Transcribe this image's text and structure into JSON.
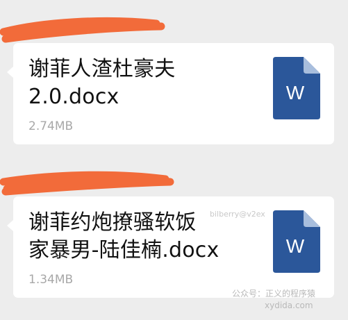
{
  "chat": {
    "messages": [
      {
        "type": "file",
        "file_name_line1": "谢菲人渣杜豪夫",
        "file_name_line2": "2.0.docx",
        "file_size": "2.74MB",
        "icon": "word-document-icon",
        "icon_letter": "W"
      },
      {
        "type": "file",
        "file_name_line1": "谢菲约炮撩骚软饭",
        "file_name_line2": "家暴男-陆佳楠.docx",
        "file_size": "1.34MB",
        "icon": "word-document-icon",
        "icon_letter": "W"
      }
    ]
  },
  "watermarks": {
    "user": "bilberry@v2ex",
    "account": "公众号：正义的程序猿",
    "site": "xydida.com"
  },
  "colors": {
    "background": "#ededed",
    "bubble": "#ffffff",
    "redaction": "#f26b3a",
    "word_blue": "#2b579a",
    "word_fold": "#a8bedd",
    "file_size_text": "#a8a8a8"
  }
}
